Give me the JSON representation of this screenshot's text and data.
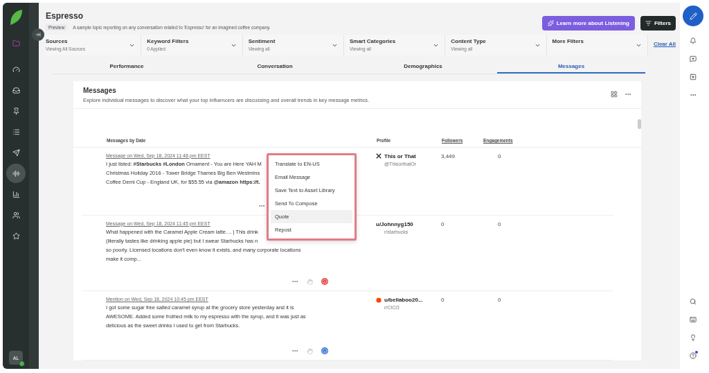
{
  "sidebar": {
    "items": [
      {
        "selected": false
      },
      {
        "selected": false
      },
      {
        "selected": false
      },
      {
        "selected": false
      },
      {
        "selected": false
      },
      {
        "selected": false
      },
      {
        "selected": true
      },
      {
        "selected": false
      },
      {
        "selected": false
      },
      {
        "selected": false
      }
    ],
    "avatar": "AL"
  },
  "header": {
    "title": "Espresso",
    "badge": "Preview",
    "description": "A sample topic reporting on any conversation related to 'Espresso' for an imagined coffee company.",
    "learn_button": "Learn more about Listening",
    "filters_button": "Filters"
  },
  "filters": [
    {
      "label": "Sources",
      "value": "Viewing All Sources"
    },
    {
      "label": "Keyword Filters",
      "value": "0 Applied"
    },
    {
      "label": "Sentiment",
      "value": "Viewing all"
    },
    {
      "label": "Smart Categories",
      "value": "Viewing all"
    },
    {
      "label": "Content Type",
      "value": "Viewing all"
    },
    {
      "label": "More Filters"
    }
  ],
  "clear_all": "Clear All",
  "tabs": [
    {
      "label": "Performance",
      "selected": false
    },
    {
      "label": "Conversation",
      "selected": false
    },
    {
      "label": "Demographics",
      "selected": false
    },
    {
      "label": "Messages",
      "selected": true
    }
  ],
  "card": {
    "title": "Messages",
    "description": "Explore individual messages to discover what your top influencers are discussing and overall trends in key message metrics.",
    "columns": [
      "Messages by Date",
      "Profile",
      "Followers",
      "Engagements"
    ],
    "rows": [
      {
        "meta": "Message on Wed, Sep 18, 2024 11:48 pm EEST",
        "lines": [
          "I just listed: **#Starbucks** **#London** Ornament - You are Here YAH M",
          "Christmas Holiday 2016 - Tower Bridge Thames Big Ben Westmins",
          "Coffee Demi Cup - England UK, for $55.55 via **@amazon** **https://t.**"
        ],
        "name": "This or That",
        "handle": "@ThisorthatOr",
        "followers": "3,449",
        "engagements": "0"
      },
      {
        "meta": "Message on Wed, Sep 18, 2024 11:45 pm EEST",
        "lines": [
          "What happened with the Caramel Apple Cream latte.... | This drink",
          "(literally tastes like drinking apple pie) but I swear Starbucks has n",
          "so poorly. Licensed locations don't even know it exists, and many corporate locations",
          "make it comp..."
        ],
        "name": "u/Johnnyg150",
        "handle": "r/starbucks",
        "followers": "0",
        "engagements": "0"
      },
      {
        "meta": "Mention on Wed, Sep 18, 2024 10:45 pm EEST",
        "lines": [
          "I got some sugar free salted caramel syrup at the grocery store yesterday and it is",
          "AWESOME. Added some frothed milk to my espresso with the syrup, and it was just as",
          "delicious as the sweet drinks I used to get from Starbucks."
        ],
        "name": "u/bellaboo20...",
        "handle": "r/CICO",
        "followers": "0",
        "engagements": "0"
      }
    ]
  },
  "context_menu": {
    "items": [
      {
        "label": "Translate to EN-US",
        "selected": false
      },
      {
        "label": "Email Message",
        "selected": false
      },
      {
        "label": "Save Text to Asset Library",
        "selected": false
      },
      {
        "label": "Send To Compose",
        "selected": false
      },
      {
        "label": "Quote",
        "selected": true
      },
      {
        "label": "Repost",
        "selected": false
      }
    ]
  }
}
